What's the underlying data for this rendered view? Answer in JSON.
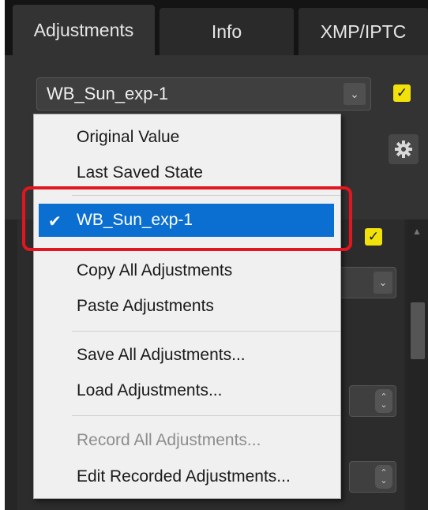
{
  "tabs": [
    {
      "label": "Adjustments"
    },
    {
      "label": "Info"
    },
    {
      "label": "XMP/IPTC"
    }
  ],
  "preset_select": {
    "value": "WB_Sun_exp-1"
  },
  "checkbox_mark": "✓",
  "menu": {
    "items": [
      {
        "label": "Original Value",
        "enabled": true
      },
      {
        "label": "Last Saved State",
        "enabled": true
      },
      {
        "label": "WB_Sun_exp-1",
        "enabled": true,
        "selected": true
      },
      {
        "label": "Copy All Adjustments",
        "enabled": true
      },
      {
        "label": "Paste Adjustments",
        "enabled": true
      },
      {
        "label": "Save All Adjustments...",
        "enabled": true
      },
      {
        "label": "Load Adjustments...",
        "enabled": true
      },
      {
        "label": "Record All Adjustments...",
        "enabled": false
      },
      {
        "label": "Edit Recorded Adjustments...",
        "enabled": true
      }
    ]
  },
  "colors": {
    "selection": "#0a6fd1",
    "highlight_border": "#e3151f",
    "checkbox": "#f2e20c"
  },
  "icons": [
    "chevron-down-icon",
    "gear-icon",
    "checkmark-icon",
    "spinner-arrows-icon",
    "scroll-up-icon"
  ]
}
